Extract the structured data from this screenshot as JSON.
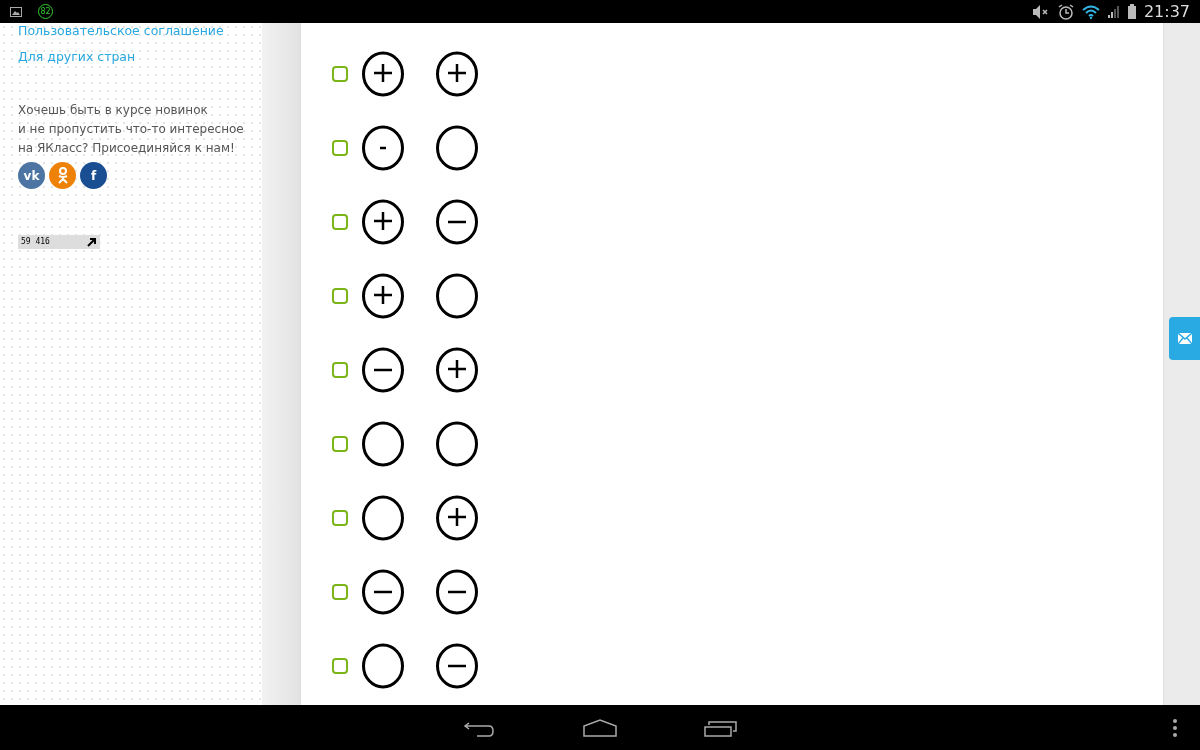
{
  "status_bar": {
    "notification_count": "82",
    "time": "21:37"
  },
  "sidebar": {
    "links": [
      "Пользовательское соглашение",
      "Для других стран"
    ],
    "subscribe_text": [
      "Хочешь быть в курсе новинок",
      "и не пропустить что-то интересное",
      "на ЯКласс? Присоединяйся к нам!"
    ],
    "social": [
      {
        "kind": "vk",
        "label": "vk",
        "color": "#4c75a3"
      },
      {
        "kind": "ok",
        "color": "#ee8208"
      },
      {
        "kind": "fb",
        "label": "f",
        "color": "#1a4e93"
      }
    ],
    "counter": "59 416"
  },
  "options": [
    {
      "checked": false,
      "signs": [
        {
          "kind": "plus"
        },
        {
          "kind": "plus"
        }
      ]
    },
    {
      "checked": false,
      "signs": [
        {
          "kind": "dash"
        },
        {
          "kind": "empty"
        }
      ]
    },
    {
      "checked": false,
      "signs": [
        {
          "kind": "plus"
        },
        {
          "kind": "minus"
        }
      ]
    },
    {
      "checked": false,
      "signs": [
        {
          "kind": "plus"
        },
        {
          "kind": "empty"
        }
      ]
    },
    {
      "checked": false,
      "signs": [
        {
          "kind": "minus"
        },
        {
          "kind": "plus"
        }
      ]
    },
    {
      "checked": false,
      "signs": [
        {
          "kind": "empty"
        },
        {
          "kind": "empty"
        }
      ]
    },
    {
      "checked": false,
      "signs": [
        {
          "kind": "empty"
        },
        {
          "kind": "plus"
        }
      ]
    },
    {
      "checked": false,
      "signs": [
        {
          "kind": "minus"
        },
        {
          "kind": "minus"
        }
      ]
    },
    {
      "checked": false,
      "signs": [
        {
          "kind": "empty"
        },
        {
          "kind": "minus"
        }
      ]
    }
  ]
}
